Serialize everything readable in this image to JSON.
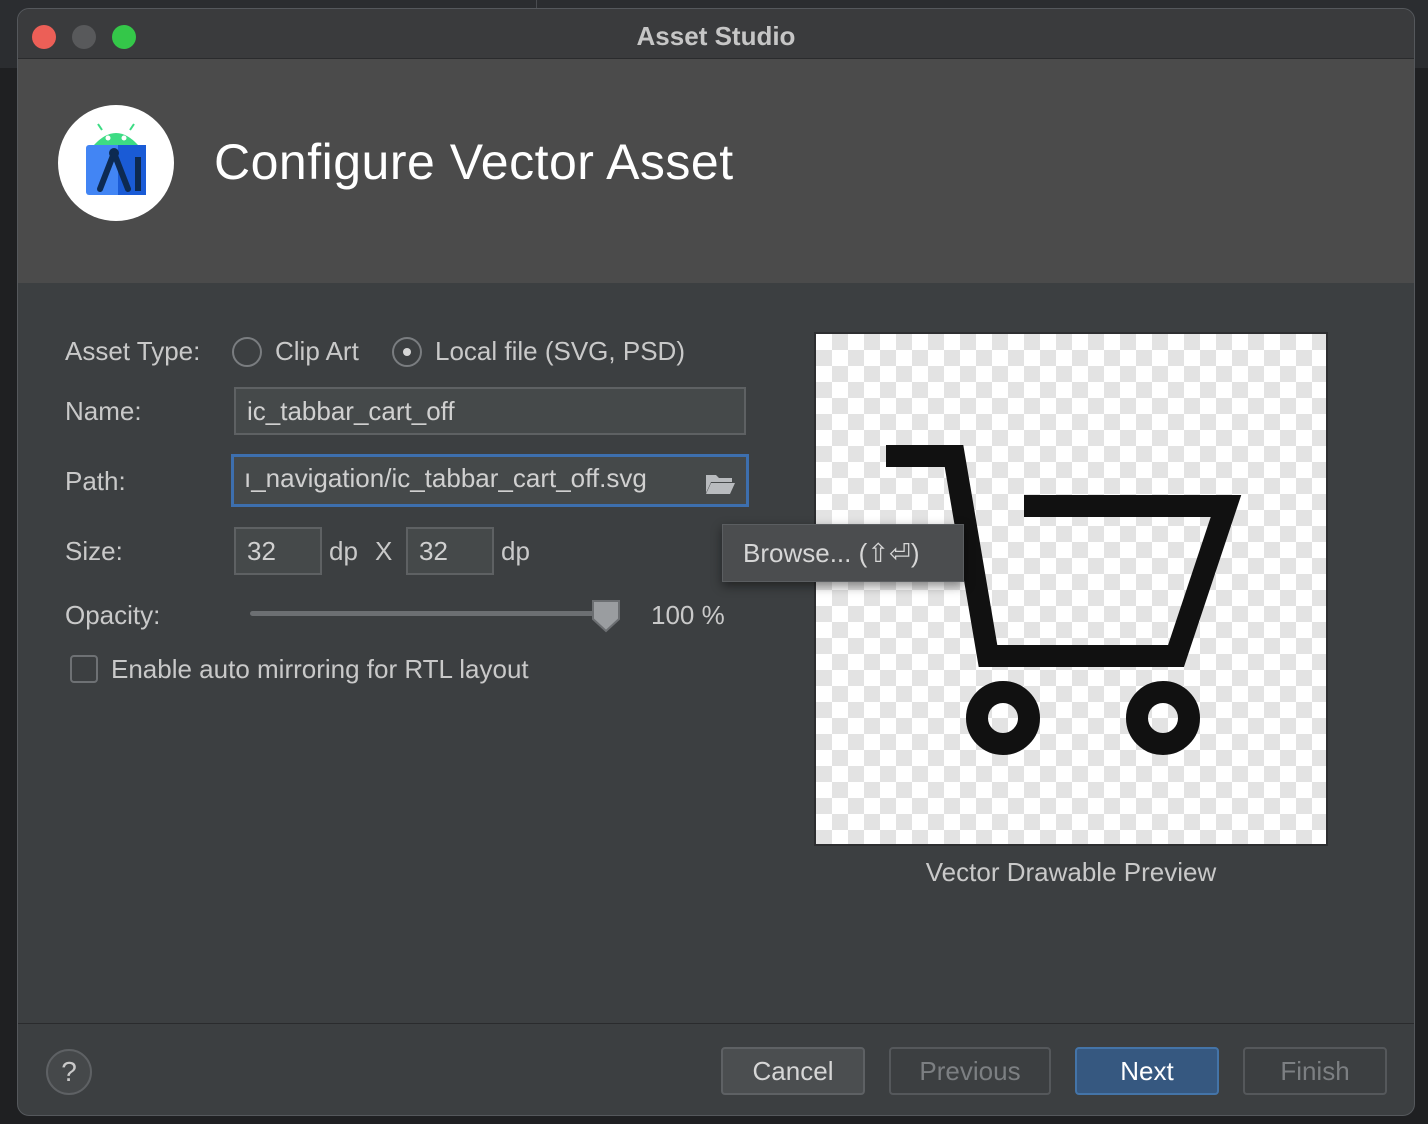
{
  "window": {
    "title": "Asset Studio",
    "header_title": "Configure Vector Asset"
  },
  "form": {
    "asset_type_label": "Asset Type:",
    "asset_type_options": [
      "Clip Art",
      "Local file (SVG, PSD)"
    ],
    "asset_type_selected": "Local file (SVG, PSD)",
    "name_label": "Name:",
    "name_value": "ic_tabbar_cart_off",
    "path_label": "Path:",
    "path_value": "ı_navigation/ic_tabbar_cart_off.svg",
    "size_label": "Size:",
    "size_width": "32",
    "size_height": "32",
    "size_unit": "dp",
    "size_separator": "X",
    "opacity_label": "Opacity:",
    "opacity_value": "100 %",
    "opacity_fraction": 1.0,
    "rtl_label": "Enable auto mirroring for RTL layout",
    "rtl_checked": false
  },
  "tooltip": {
    "text": "Browse... (⇧⏎)"
  },
  "preview": {
    "caption": "Vector Drawable Preview",
    "icon": "shopping-cart-icon"
  },
  "footer": {
    "help_label": "?",
    "cancel_label": "Cancel",
    "previous_label": "Previous",
    "next_label": "Next",
    "finish_label": "Finish"
  },
  "colors": {
    "window_bg": "#3c3f41",
    "header_bg": "#4b4b4b",
    "accent": "#365880",
    "focus_border": "#3d6fae",
    "close": "#ec5f57",
    "maximize": "#34c749"
  }
}
